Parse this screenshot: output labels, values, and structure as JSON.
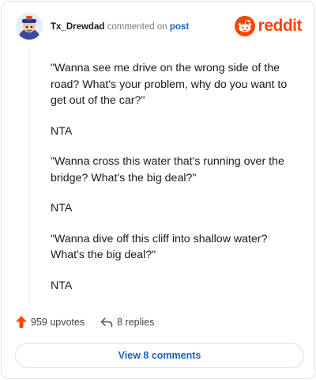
{
  "comment": {
    "username": "Tx_Drewdad",
    "action_text": "commented on",
    "post_link": "post",
    "paragraphs": [
      "\"Wanna see me drive on the wrong side of the road? What's your problem, why do you want to get out of the car?\"",
      "NTA",
      "\"Wanna cross this water that's running over the bridge? What's the big deal?\"",
      "NTA",
      "\"Wanna dive off this cliff into shallow water? What's the big deal?\"",
      "NTA"
    ]
  },
  "brand": {
    "wordmark": "reddit",
    "color": "#ff4500"
  },
  "actions": {
    "upvotes": "959 upvotes",
    "replies": "8 replies"
  },
  "view_comments_label": "View 8 comments",
  "colors": {
    "accent": "#ff4500",
    "link": "#1d5ec7"
  }
}
